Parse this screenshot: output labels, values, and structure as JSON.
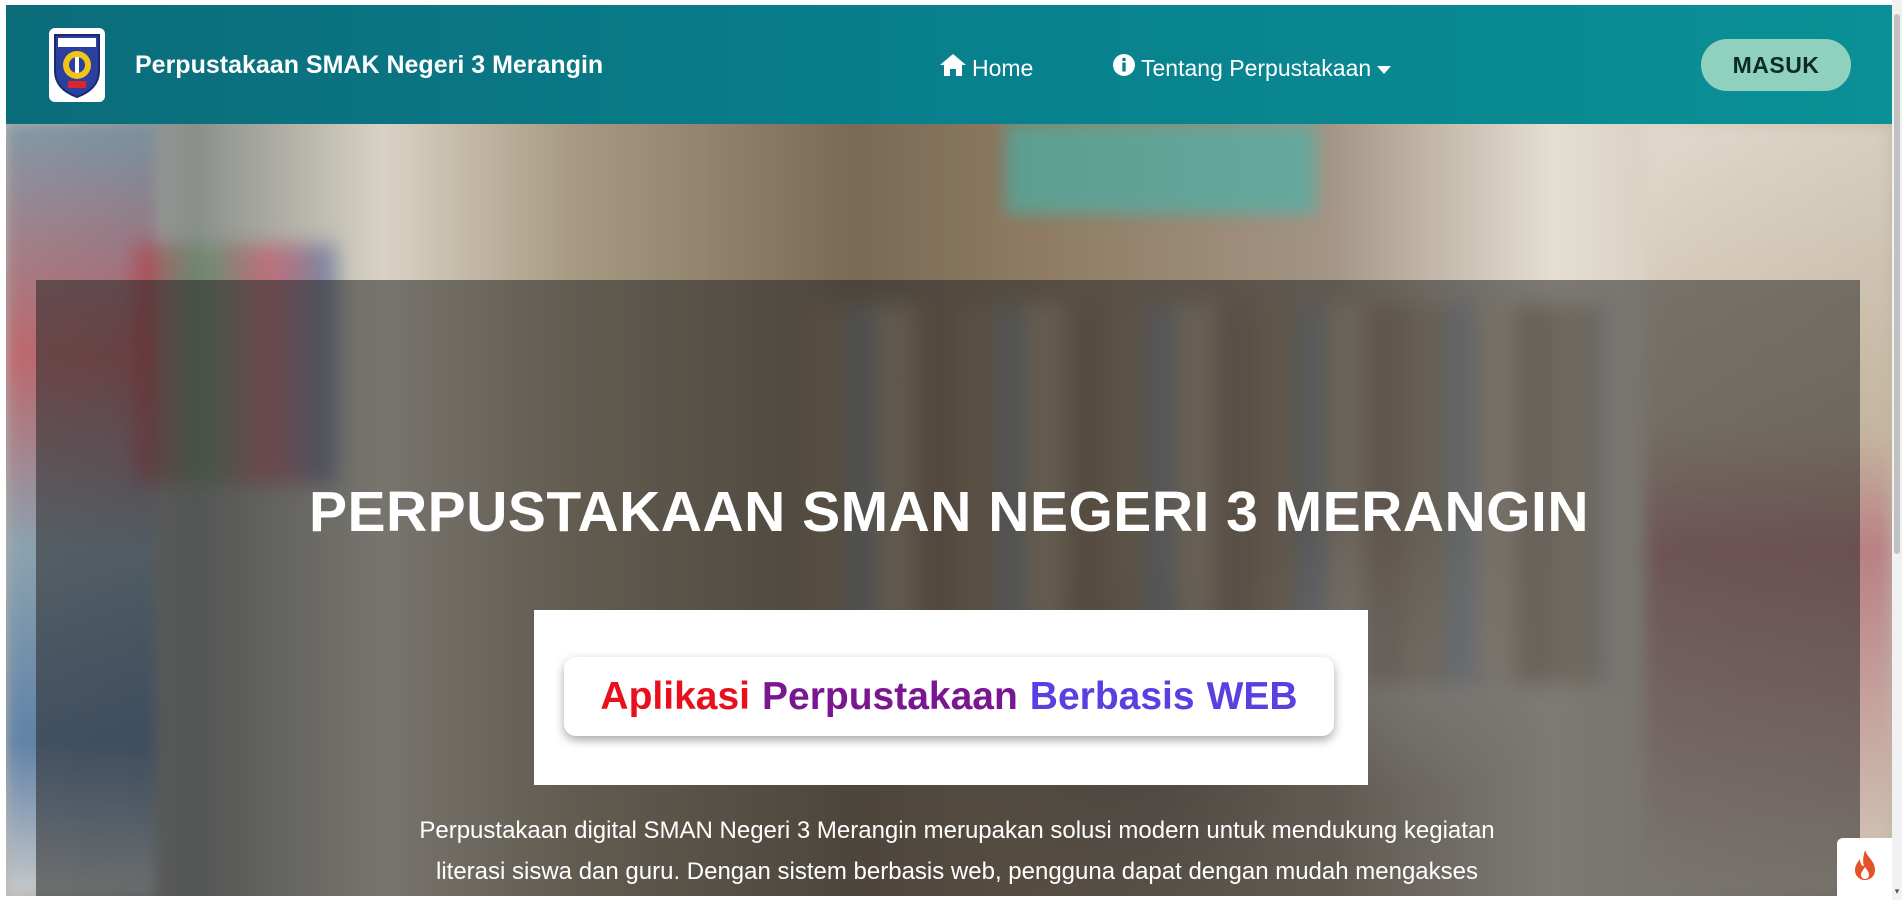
{
  "navbar": {
    "brand": "Perpustakaan SMAK Negeri 3 Merangin",
    "home_label": "Home",
    "about_label": "Tentang Perpustakaan",
    "login_label": "MASUK"
  },
  "hero": {
    "title": "PERPUSTAKAAN SMAN NEGERI 3 MERANGIN",
    "tagline": {
      "word1": "Aplikasi",
      "word2": "Perpustakaan",
      "word3": "Berbasis",
      "word4": "WEB"
    },
    "description_line1": "Perpustakaan digital SMAN Negeri 3 Merangin merupakan solusi modern untuk mendukung kegiatan",
    "description_line2": "literasi siswa dan guru. Dengan sistem berbasis web, pengguna dapat dengan mudah mengakses"
  },
  "colors": {
    "navbar_start": "#0b6c7a",
    "navbar_end": "#0a9096",
    "login_button": "#8fd1bd",
    "tag_red": "#e8101c",
    "tag_purple": "#7a1690",
    "tag_violet": "#5b3fe0"
  },
  "icons": {
    "logo": "school-crest-icon",
    "home": "home-icon",
    "about": "info-circle-icon",
    "dropdown": "caret-down-icon",
    "fire": "fire-icon"
  }
}
